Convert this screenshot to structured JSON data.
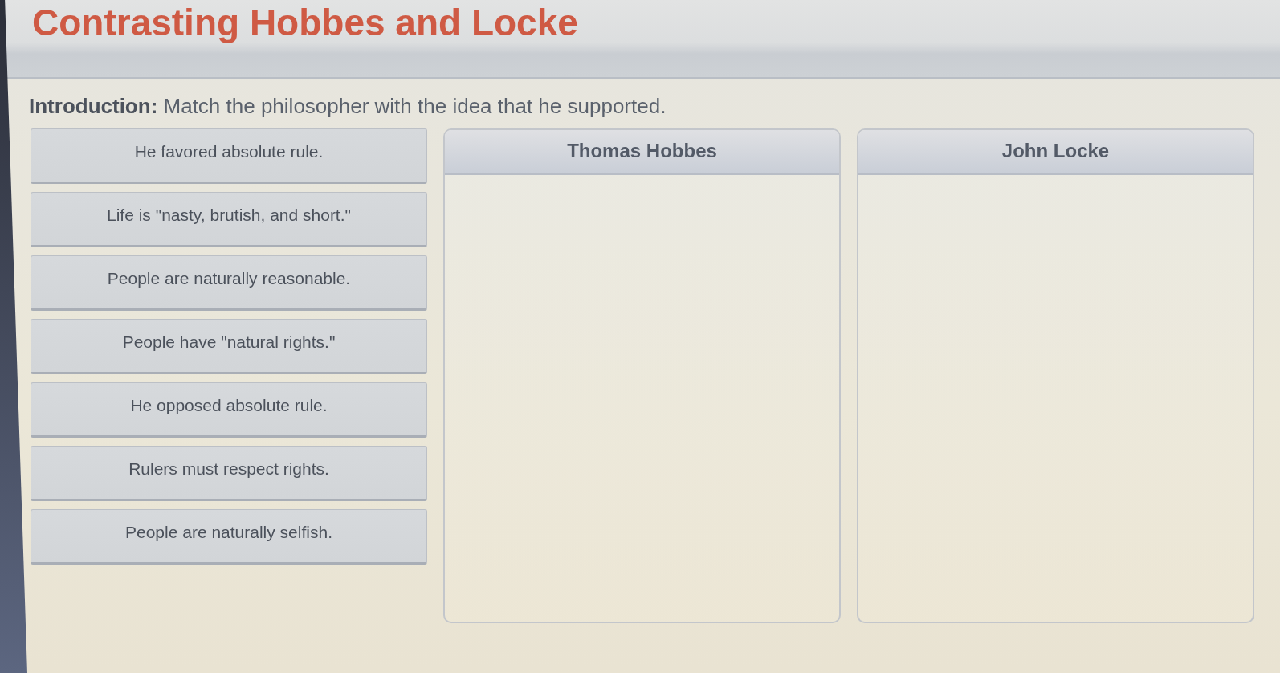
{
  "title": "Contrasting Hobbes and Locke",
  "introduction": "**Introduction:** Match the philosopher with the idea that he supported.",
  "statements": [
    "He favored absolute rule.",
    "Life is \"nasty, brutish, and short.\"",
    "People are naturally reasonable.",
    "People have \"natural rights.\"",
    "He opposed absolute rule.",
    "Rulers must respect rights.",
    "People are naturally selfish."
  ],
  "categories": [
    {
      "title": "Thomas Hobbes"
    },
    {
      "title": "John Locke"
    }
  ]
}
